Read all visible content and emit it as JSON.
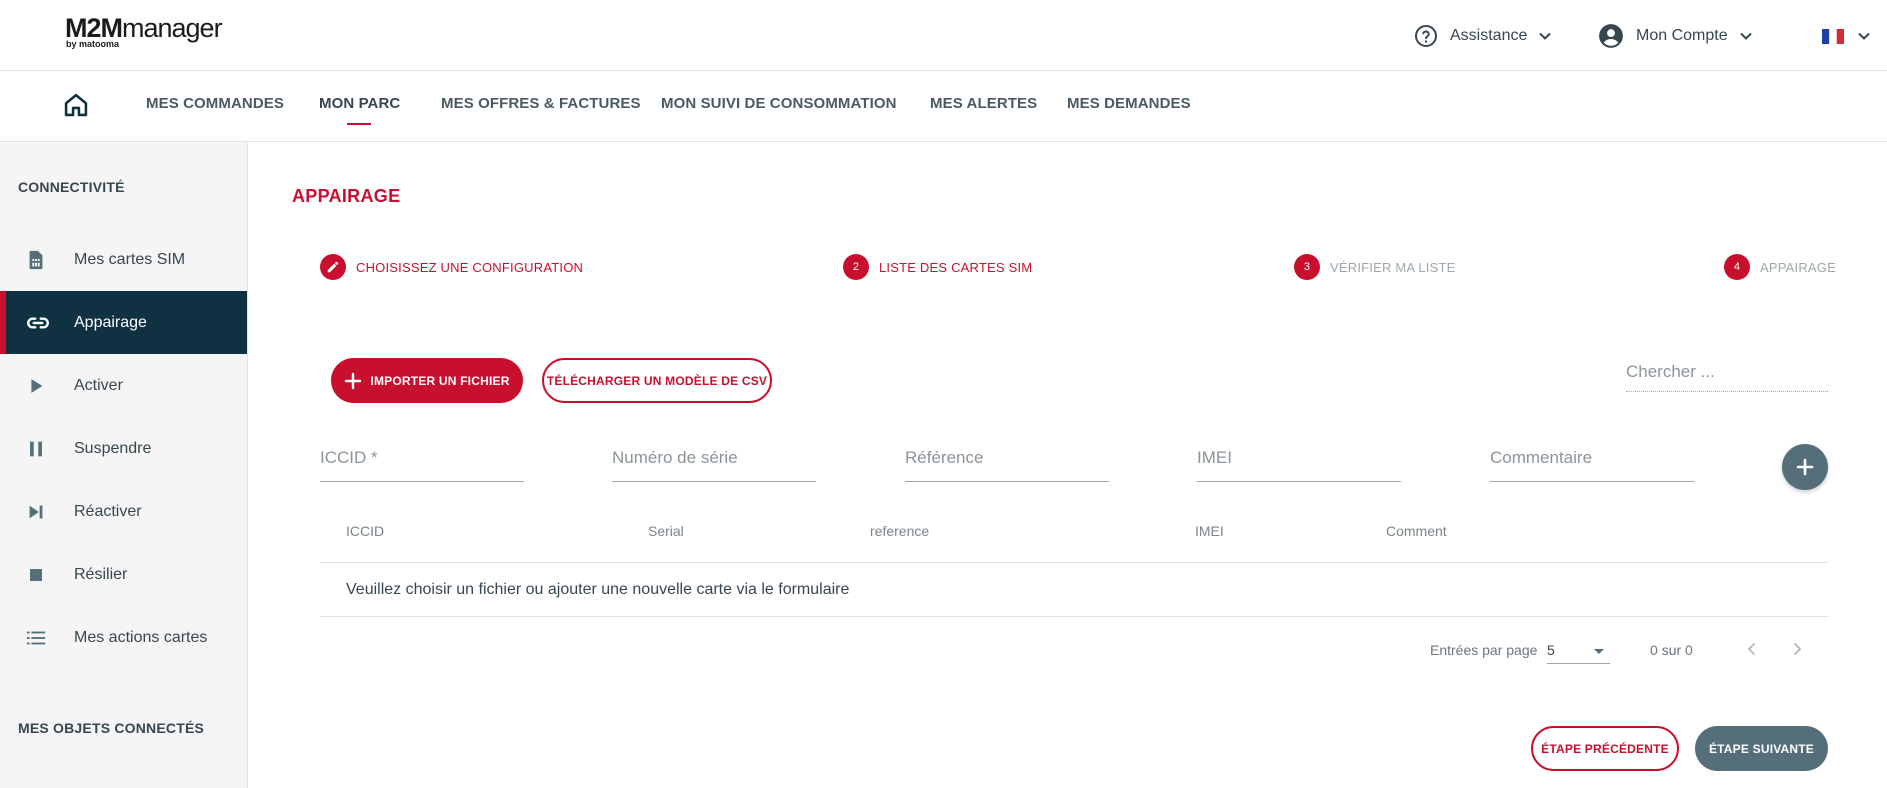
{
  "header": {
    "logo_main_bold": "M2M",
    "logo_main_light": "manager",
    "logo_sub": "by matooma",
    "assistance_label": "Assistance",
    "account_label": "Mon Compte",
    "language_icon": "flag-fr-icon"
  },
  "nav": {
    "items": [
      {
        "label": "MES COMMANDES"
      },
      {
        "label": "MON PARC"
      },
      {
        "label": "MES OFFRES & FACTURES"
      },
      {
        "label": "MON SUIVI DE CONSOMMATION"
      },
      {
        "label": "MES ALERTES"
      },
      {
        "label": "MES DEMANDES"
      }
    ],
    "active": "MON PARC"
  },
  "sidebar": {
    "section1": "CONNECTIVITÉ",
    "items": [
      {
        "label": "Mes cartes SIM",
        "icon": "sim-card-icon"
      },
      {
        "label": "Appairage",
        "icon": "link-icon"
      },
      {
        "label": "Activer",
        "icon": "play-icon"
      },
      {
        "label": "Suspendre",
        "icon": "pause-icon"
      },
      {
        "label": "Réactiver",
        "icon": "skip-next-icon"
      },
      {
        "label": "Résilier",
        "icon": "stop-icon"
      },
      {
        "label": "Mes actions cartes",
        "icon": "list-icon"
      }
    ],
    "active": "Appairage",
    "section2": "MES OBJETS CONNECTÉS"
  },
  "main": {
    "title": "APPAIRAGE",
    "steps": [
      {
        "num": "",
        "label": "CHOISISSEZ UNE CONFIGURATION",
        "state": "done"
      },
      {
        "num": "2",
        "label": "LISTE DES CARTES SIM",
        "state": "current"
      },
      {
        "num": "3",
        "label": "VÉRIFIER MA LISTE",
        "state": "todo"
      },
      {
        "num": "4",
        "label": "APPAIRAGE",
        "state": "todo"
      }
    ],
    "import_button": "IMPORTER UN FICHIER",
    "download_button": "TÉLÉCHARGER UN MODÈLE DE CSV",
    "search_placeholder": "Chercher ...",
    "form_fields": [
      {
        "placeholder": "ICCID *"
      },
      {
        "placeholder": "Numéro de série"
      },
      {
        "placeholder": "Référence"
      },
      {
        "placeholder": "IMEI"
      },
      {
        "placeholder": "Commentaire"
      }
    ],
    "table": {
      "columns": [
        "ICCID",
        "Serial",
        "reference",
        "IMEI",
        "Comment"
      ],
      "empty_message": "Veuillez choisir un fichier ou ajouter une nouvelle carte via le formulaire"
    },
    "pagination": {
      "per_page_label": "Entrées par page",
      "per_page_value": "5",
      "range_label": "0 sur 0"
    },
    "prev_step_button": "ÉTAPE PRÉCÉDENTE",
    "next_step_button": "ÉTAPE SUIVANTE"
  },
  "colors": {
    "accent_red": "#c8102e",
    "sidebar_active_bg": "#103142",
    "grey_button": "#546e7a"
  }
}
